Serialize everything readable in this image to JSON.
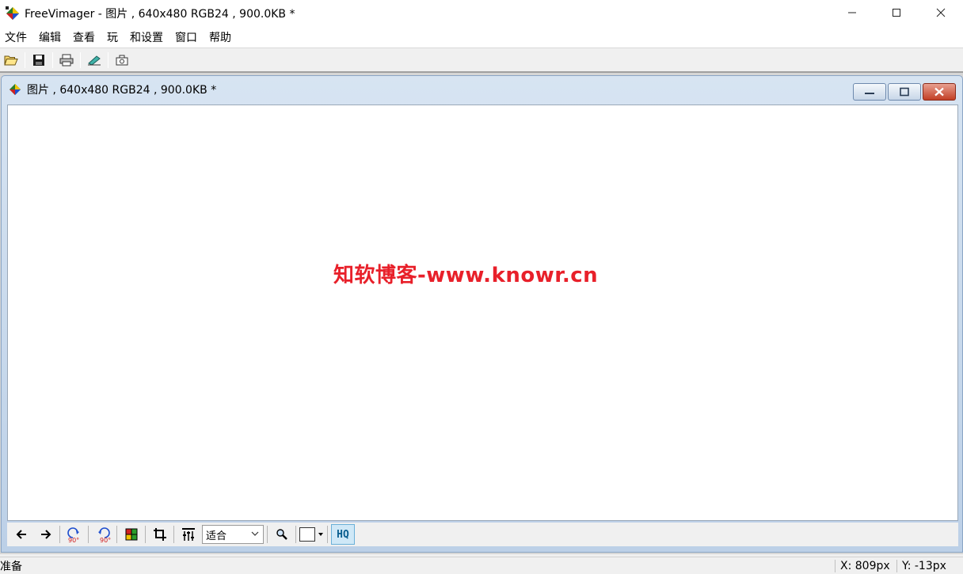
{
  "window": {
    "title": "FreeVimager - 图片 , 640x480 RGB24 , 900.0KB *",
    "controls": {
      "minimize": "—",
      "maximize": "☐",
      "close": "✕"
    }
  },
  "menu": {
    "items": [
      {
        "label": "文件"
      },
      {
        "label": "编辑"
      },
      {
        "label": "查看"
      },
      {
        "label": "玩"
      },
      {
        "label": "和设置"
      },
      {
        "label": "窗口"
      },
      {
        "label": "帮助"
      }
    ]
  },
  "toolbar": {
    "icons": [
      "open-folder-icon",
      "save-icon",
      "print-icon",
      "scan-icon",
      "capture-icon"
    ]
  },
  "child": {
    "title": "图片 , 640x480 RGB24 , 900.0KB *",
    "watermark": "知软博客-www.knowr.cn"
  },
  "child_toolbar": {
    "zoom_value": "适合",
    "rotate_label": "90°",
    "hq_label": "HQ"
  },
  "status": {
    "text": "准备",
    "x": "X: 809px",
    "y": "Y: -13px"
  }
}
